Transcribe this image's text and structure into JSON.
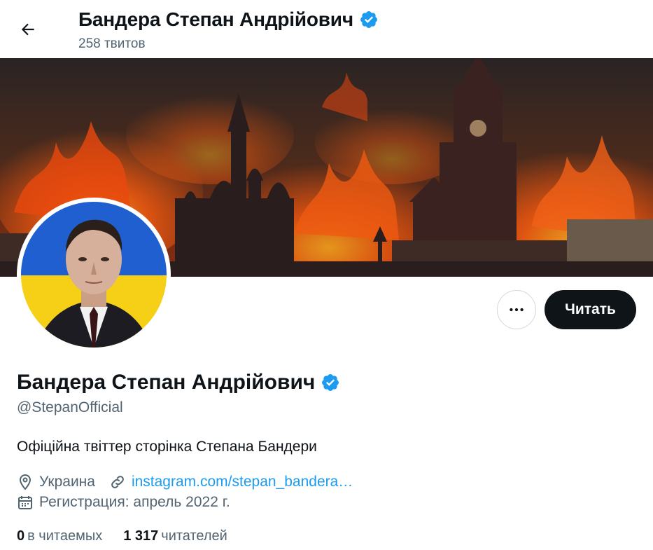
{
  "header": {
    "title": "Бандера Степан Андрійович",
    "tweets_count": "258 твитов"
  },
  "profile": {
    "name": "Бандера Степан Андрійович",
    "handle": "@StepanOfficial",
    "bio": "Офіційна твіттер сторінка Степана Бандери",
    "location": "Украина",
    "website": "instagram.com/stepan_bandera…",
    "joined": "Регистрация: апрель 2022 г."
  },
  "actions": {
    "more_label": "•••",
    "follow_label": "Читать"
  },
  "stats": {
    "following_count": "0",
    "following_label": "в читаемых",
    "followers_count": "1 317",
    "followers_label": "читателей"
  },
  "colors": {
    "accent": "#1d9bf0",
    "text": "#0f1419",
    "secondary": "#536471",
    "verified": "#1d9bf0"
  },
  "icons": {
    "back": "arrow-left-icon",
    "verified": "verified-badge-icon",
    "location": "location-pin-icon",
    "link": "link-icon",
    "calendar": "calendar-icon",
    "more": "more-dots-icon"
  }
}
